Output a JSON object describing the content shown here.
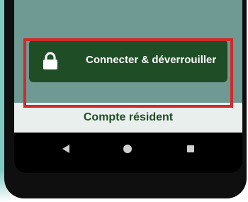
{
  "main_button": {
    "label": "Connecter & déverrouiller",
    "icon": "lock-icon"
  },
  "resident_account": {
    "label": "Compte résident"
  },
  "navigation": {
    "back_icon": "back-triangle-icon",
    "home_icon": "home-circle-icon",
    "recents_icon": "recents-square-icon"
  },
  "colors": {
    "screen_bg": "#6f9993",
    "button_bg": "#1f4d25",
    "highlight": "#d12a2a",
    "resident_bar_bg": "#e9efed",
    "resident_text": "#1f4d25",
    "side_accent": "#7fc9c1"
  }
}
